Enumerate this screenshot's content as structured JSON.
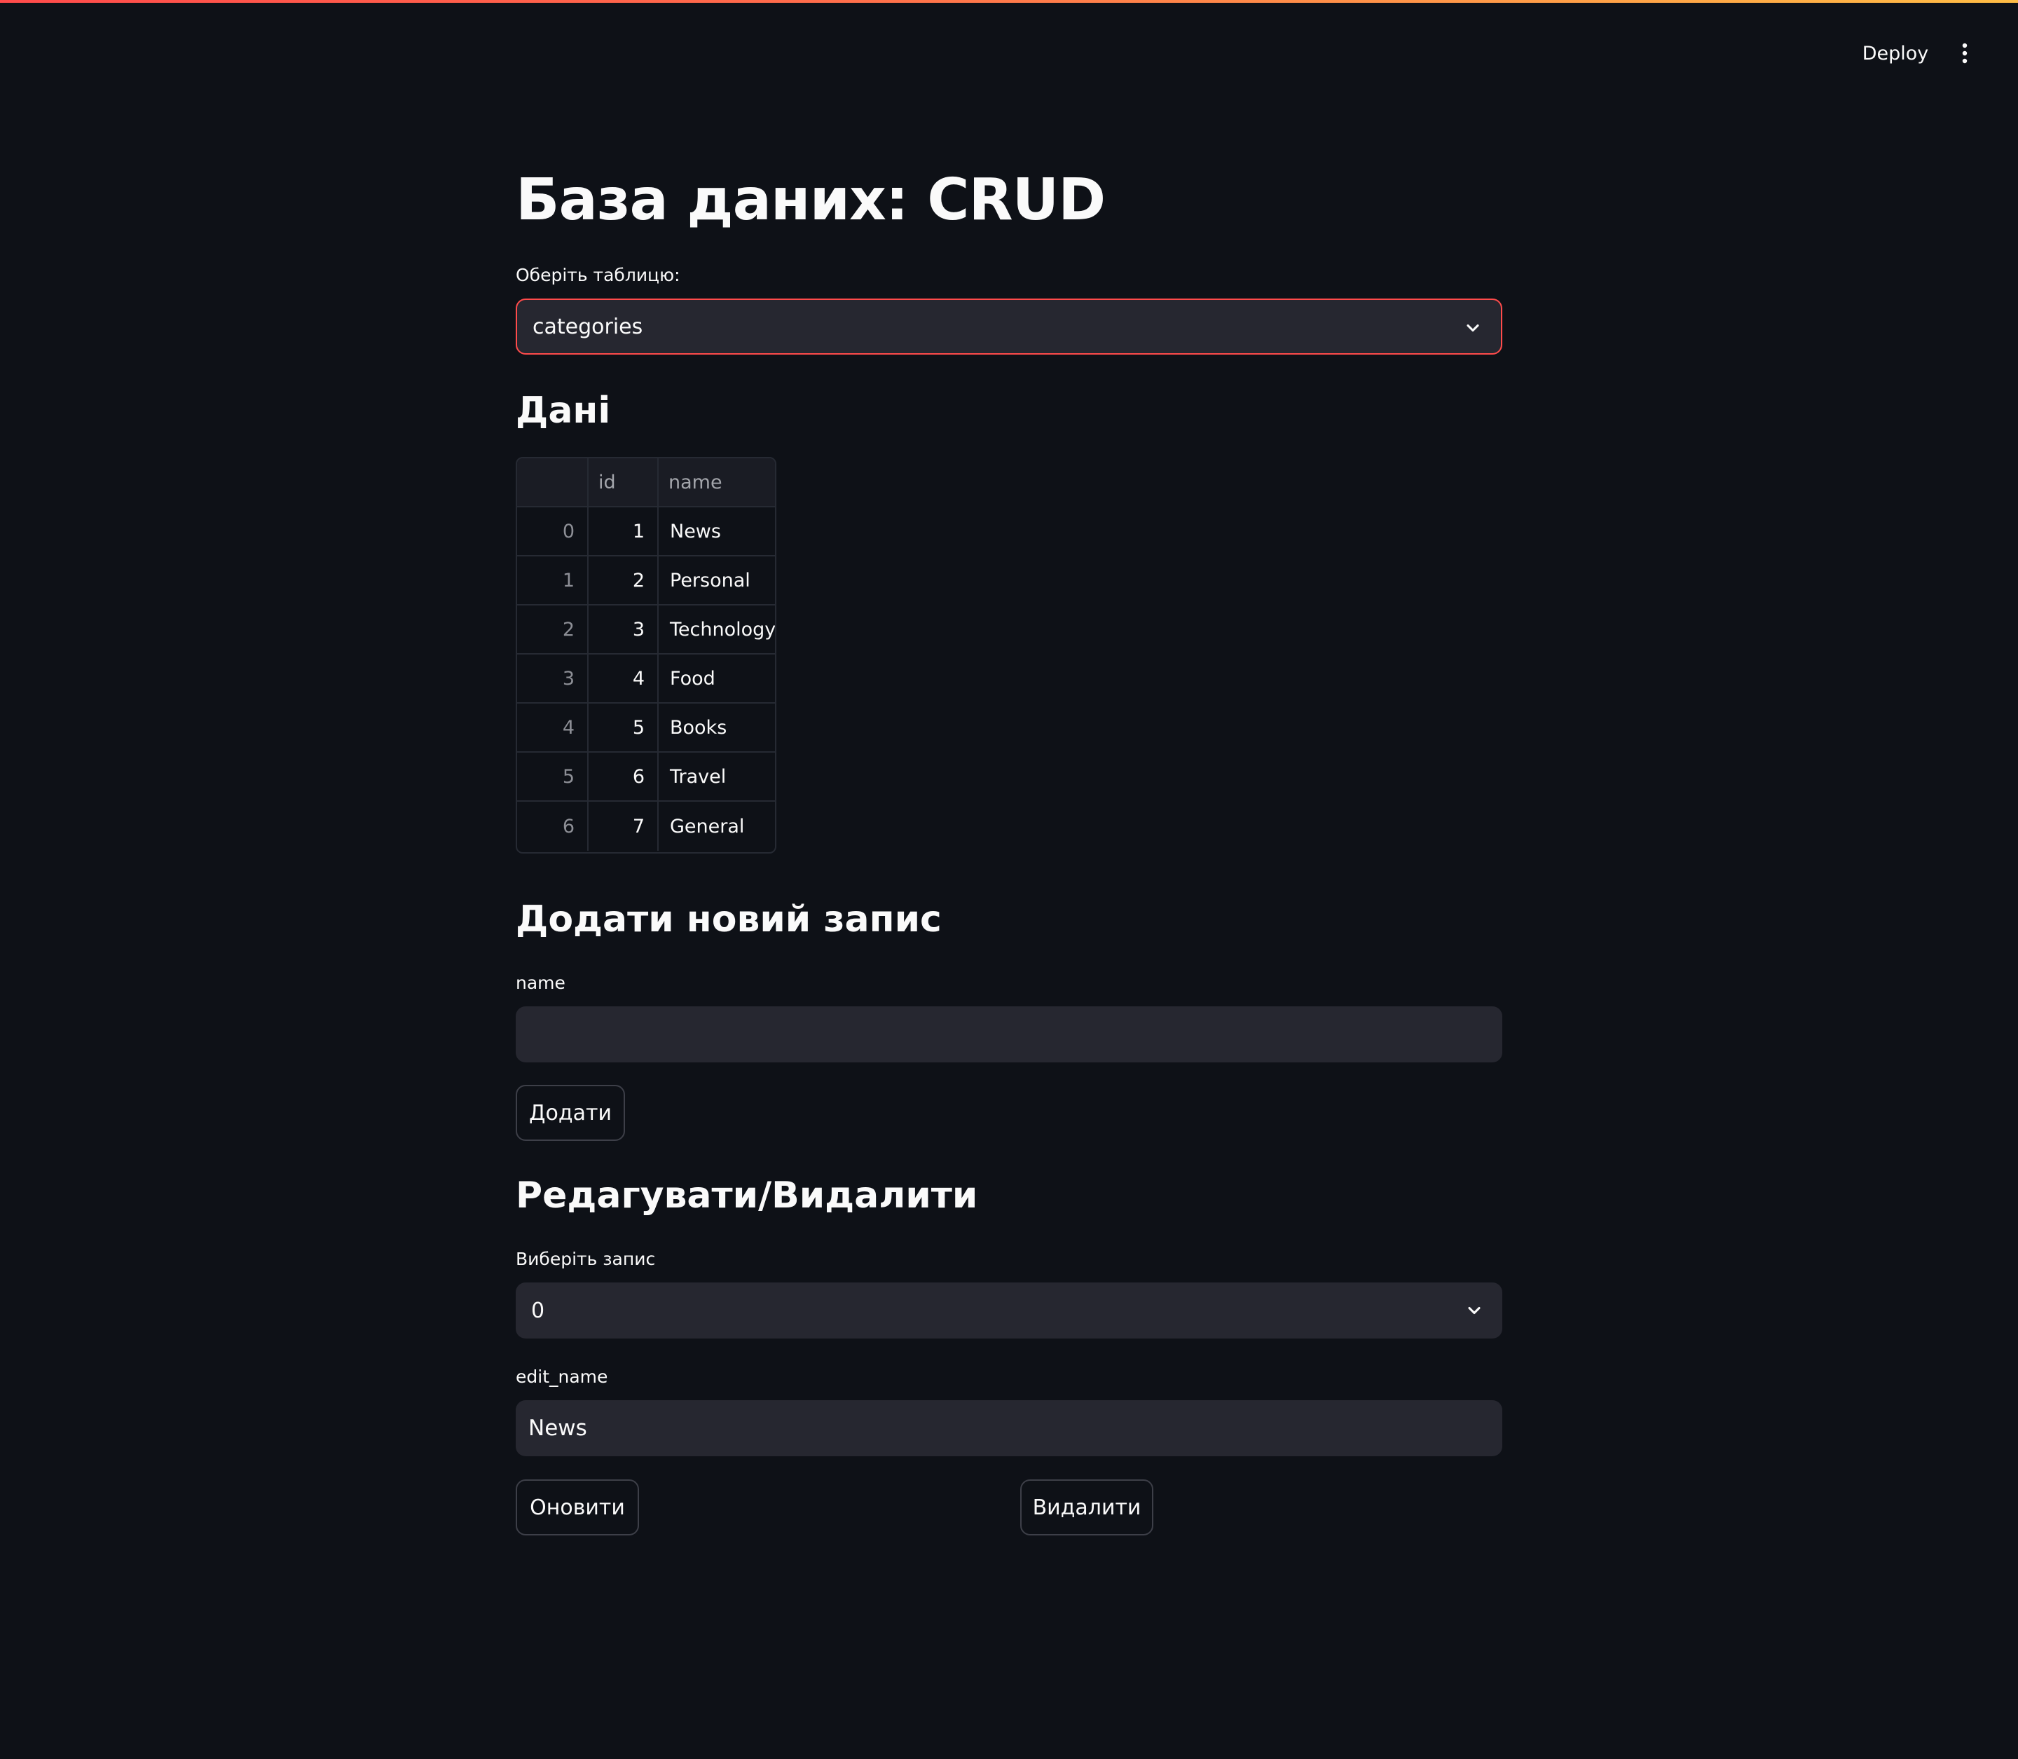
{
  "header": {
    "deploy_label": "Deploy",
    "menu_icon": "more-vertical-icon"
  },
  "colors": {
    "background": "#0e1117",
    "input_background": "#262730",
    "focus_border": "#ff4b4b",
    "accent_gradient": [
      "#ff4b4b",
      "#ffbd45"
    ]
  },
  "page": {
    "title": "База даних: CRUD"
  },
  "table_select": {
    "label": "Оберіть таблицю:",
    "value": "categories"
  },
  "data_section": {
    "heading": "Дані",
    "columns": [
      "",
      "id",
      "name"
    ],
    "rows": [
      {
        "index": "0",
        "id": "1",
        "name": "News"
      },
      {
        "index": "1",
        "id": "2",
        "name": "Personal"
      },
      {
        "index": "2",
        "id": "3",
        "name": "Technology"
      },
      {
        "index": "3",
        "id": "4",
        "name": "Food"
      },
      {
        "index": "4",
        "id": "5",
        "name": "Books"
      },
      {
        "index": "5",
        "id": "6",
        "name": "Travel"
      },
      {
        "index": "6",
        "id": "7",
        "name": "General"
      }
    ]
  },
  "add_section": {
    "heading": "Додати новий запис",
    "name_label": "name",
    "name_value": "",
    "add_button": "Додати"
  },
  "edit_section": {
    "heading": "Редагувати/Видалити",
    "record_label": "Виберіть запис",
    "record_value": "0",
    "edit_name_label": "edit_name",
    "edit_name_value": "News",
    "update_button": "Оновити",
    "delete_button": "Видалити"
  }
}
